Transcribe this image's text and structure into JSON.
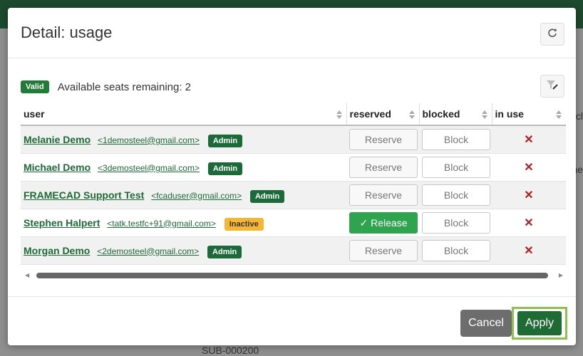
{
  "backdrop": {
    "bottom_text": "SUB-000200",
    "edge_char_1": "cl",
    "edge_char_2": "ne"
  },
  "dialog": {
    "title": "Detail: usage",
    "valid_badge": "Valid",
    "seats_text": "Available seats remaining: 2",
    "columns": [
      "user",
      "reserved",
      "blocked",
      "in use"
    ],
    "rows": [
      {
        "name": "Melanie Demo",
        "email": "<1demosteel@gmail.com>",
        "role": "Admin",
        "reserved": "Reserve",
        "blocked": "Block",
        "in_use": "✕"
      },
      {
        "name": "Michael Demo",
        "email": "<3demosteel@gmail.com>",
        "role": "Admin",
        "reserved": "Reserve",
        "blocked": "Block",
        "in_use": "✕"
      },
      {
        "name": "FRAMECAD Support Test",
        "email": "<fcaduser@gmail.com>",
        "role": "Admin",
        "reserved": "Reserve",
        "blocked": "Block",
        "in_use": "✕"
      },
      {
        "name": "Stephen Halpert",
        "email": "<tatk.testfc+91@gmail.com>",
        "role": "Inactive",
        "reserved": "✓ Release",
        "blocked": "Block",
        "in_use": "✕"
      },
      {
        "name": "Morgan Demo",
        "email": "<2demosteel@gmail.com>",
        "role": "Admin",
        "reserved": "Reserve",
        "blocked": "Block",
        "in_use": "✕"
      }
    ],
    "cancel_label": "Cancel",
    "apply_label": "Apply"
  },
  "colors": {
    "primary_green": "#1e6b34",
    "release_green": "#2ea44f",
    "inactive_badge": "#f5b731",
    "highlight_outline": "#8bc34a",
    "x_mark": "#b81c1c"
  }
}
